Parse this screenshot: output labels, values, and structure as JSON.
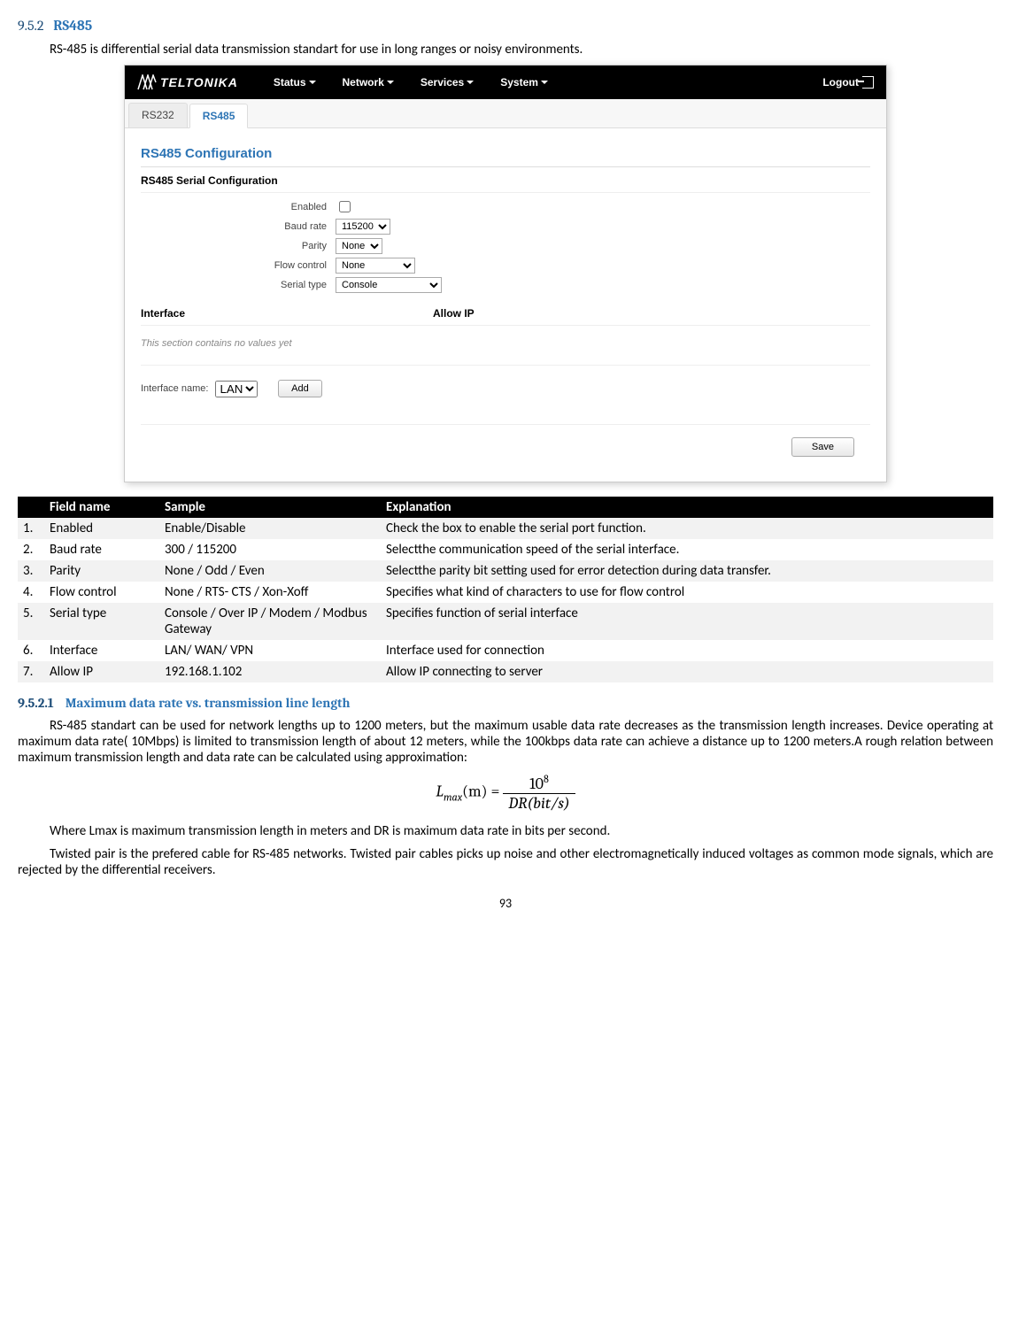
{
  "section": {
    "number": "9.5.2",
    "title": "RS485",
    "intro": "RS-485 is differential serial data transmission standart for use in long ranges or noisy environments."
  },
  "router": {
    "logo_text": "TELTONIKA",
    "nav": [
      "Status",
      "Network",
      "Services",
      "System"
    ],
    "logout": "Logout",
    "tabs": [
      "RS232",
      "RS485"
    ],
    "active_tab": "RS485",
    "config_title": "RS485 Configuration",
    "config_subtitle": "RS485 Serial Configuration",
    "form": {
      "enabled_label": "Enabled",
      "baud_label": "Baud rate",
      "baud_value": "115200",
      "parity_label": "Parity",
      "parity_value": "None",
      "flow_label": "Flow control",
      "flow_value": "None",
      "serial_label": "Serial type",
      "serial_value": "Console"
    },
    "iface_header": {
      "col1": "Interface",
      "col2": "Allow IP"
    },
    "empty_msg": "This section contains no values yet",
    "add": {
      "label": "Interface name:",
      "value": "LAN",
      "button": "Add"
    },
    "save": "Save"
  },
  "table": {
    "headers": [
      "",
      "Field name",
      "Sample",
      "Explanation"
    ],
    "rows": [
      [
        "1.",
        "Enabled",
        "Enable/Disable",
        "Check the box to enable the serial port function."
      ],
      [
        "2.",
        "Baud rate",
        "300 / 115200",
        "Selectthe communication speed of the serial interface."
      ],
      [
        "3.",
        "Parity",
        "None / Odd / Even",
        "Selectthe parity bit setting used for error detection during data transfer."
      ],
      [
        "4.",
        "Flow control",
        "None / RTS- CTS / Xon-Xoff",
        "Specifies what kind of characters to use for flow control"
      ],
      [
        "5.",
        "Serial type",
        "Console / Over IP / Modem / Modbus Gateway",
        "Specifies function of serial interface"
      ],
      [
        "6.",
        "Interface",
        "LAN/ WAN/ VPN",
        "Interface used for connection"
      ],
      [
        "7.",
        "Allow IP",
        "192.168.1.102",
        "Allow IP connecting to server"
      ]
    ]
  },
  "subsection": {
    "number": "9.5.2.1",
    "title": "Maximum data rate vs. transmission line length",
    "p1": "RS-485 standart can be used for network lengths up to 1200 meters, but the maximum usable data rate decreases as the transmission length increases. Device operating at maximum data rate( 10Mbps) is limited to transmission length of about 12 meters, while the 100kbps data rate can achieve a distance up to 1200 meters.A rough relation between maximum transmission length and data rate can be calculated using approximation:",
    "p2": "Where Lmax is maximum transmission length in meters and DR is maximum data rate in bits per second.",
    "p3": "Twisted pair is the prefered cable for RS-485 networks. Twisted pair cables picks up noise and other electromagnetically induced voltages as common mode signals, which are rejected by the differential receivers."
  },
  "formula": {
    "lhs_base": "L",
    "lhs_sub": "max",
    "lhs_arg": "(m) =",
    "top_base": "10",
    "top_sup": "8",
    "bot": "DR(bit/s)"
  },
  "page_number": "93"
}
